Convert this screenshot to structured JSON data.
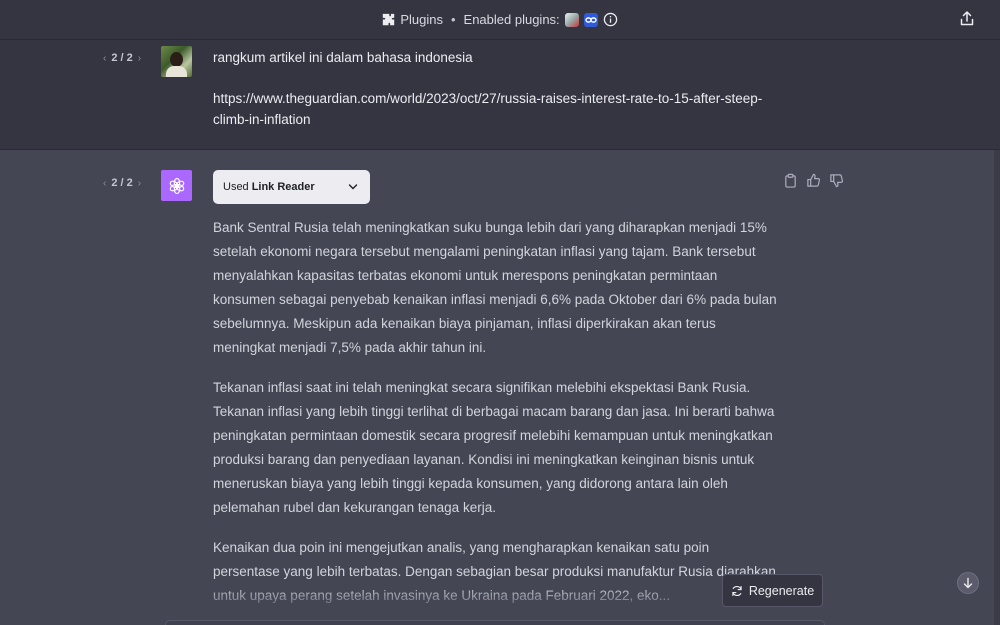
{
  "topbar": {
    "plugins_label": "Plugins",
    "separator": "•",
    "enabled_label": "Enabled plugins:",
    "plugin_icons": [
      "webpilot-icon",
      "link-reader-icon"
    ]
  },
  "user_message": {
    "pager": "2 / 2",
    "text": "rangkum artikel ini  dalam bahasa indonesia",
    "url": "https://www.theguardian.com/world/2023/oct/27/russia-raises-interest-rate-to-15-after-steep-climb-in-inflation"
  },
  "assistant_message": {
    "pager": "2 / 2",
    "plugin_used_prefix": "Used",
    "plugin_used_name": "Link Reader",
    "paragraphs": [
      "Bank Sentral Rusia telah meningkatkan suku bunga lebih dari yang diharapkan menjadi 15% setelah ekonomi negara tersebut mengalami peningkatan inflasi yang tajam. Bank tersebut menyalahkan kapasitas terbatas ekonomi untuk merespons peningkatan permintaan konsumen sebagai penyebab kenaikan inflasi menjadi 6,6% pada Oktober dari 6% pada bulan sebelumnya. Meskipun ada kenaikan biaya pinjaman, inflasi diperkirakan akan terus meningkat menjadi 7,5% pada akhir tahun ini.",
      "Tekanan inflasi saat ini telah meningkat secara signifikan melebihi ekspektasi Bank Rusia. Tekanan inflasi yang lebih tinggi terlihat di berbagai macam barang dan jasa. Ini berarti bahwa peningkatan permintaan domestik secara progresif melebihi kemampuan untuk meningkatkan produksi barang dan penyediaan layanan. Kondisi ini meningkatkan keinginan bisnis untuk meneruskan biaya yang lebih tinggi kepada konsumen, yang didorong antara lain oleh pelemahan rubel dan kekurangan tenaga kerja.",
      "Kenaikan dua poin ini mengejutkan analis, yang mengharapkan kenaikan satu poin persentase yang lebih terbatas. Dengan sebagian besar produksi manufaktur Rusia diarahkan untuk upaya perang setelah invasinya ke Ukraina pada Februari 2022, eko..."
    ]
  },
  "regenerate_label": "Regenerate",
  "colors": {
    "background": "#343541",
    "assistant_bg": "#444654",
    "openai_avatar": "#ab68ff"
  }
}
